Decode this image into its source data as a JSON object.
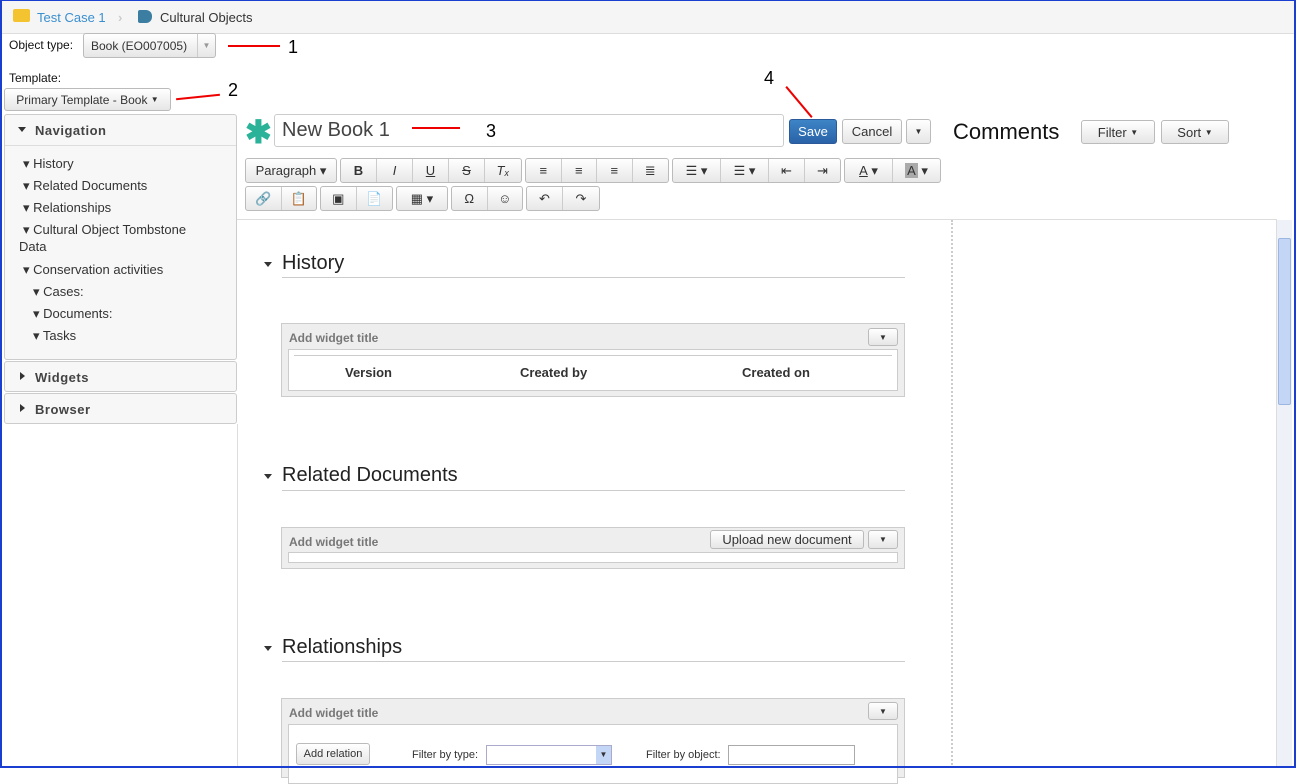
{
  "breadcrumb": {
    "items": [
      "Test Case 1",
      "Cultural Objects"
    ]
  },
  "object_type": {
    "label": "Object type:",
    "value": "Book (EO007005)"
  },
  "template": {
    "label": "Template:",
    "value": "Primary Template - Book"
  },
  "sidebar": {
    "navigation": {
      "title": "Navigation",
      "items": [
        "History",
        "Related Documents",
        "Relationships",
        "Cultural Object Tombstone",
        "Data",
        "Conservation activities",
        "Cases:",
        "Documents:",
        "Tasks"
      ]
    },
    "widgets": "Widgets",
    "browser": "Browser"
  },
  "editor": {
    "title_value": "New Book 1",
    "save": "Save",
    "cancel": "Cancel",
    "format": "Paragraph"
  },
  "comments": {
    "title": "Comments",
    "filter": "Filter",
    "sort": "Sort"
  },
  "annotations": [
    "1",
    "2",
    "3",
    "4"
  ],
  "sections": [
    {
      "title": "History",
      "widget_title": "Add widget title",
      "columns": [
        "Version",
        "Created by",
        "Created on"
      ]
    },
    {
      "title": "Related Documents",
      "widget_title": "Add widget title",
      "upload": "Upload new document"
    },
    {
      "title": "Relationships",
      "widget_title": "Add widget title",
      "add_relation": "Add relation",
      "filter_type": "Filter by type:",
      "filter_object": "Filter by object:"
    }
  ],
  "colors": {
    "accent": "#2f6fb3",
    "brand_green": "#2bb39a",
    "annotation": "#ee0000"
  }
}
